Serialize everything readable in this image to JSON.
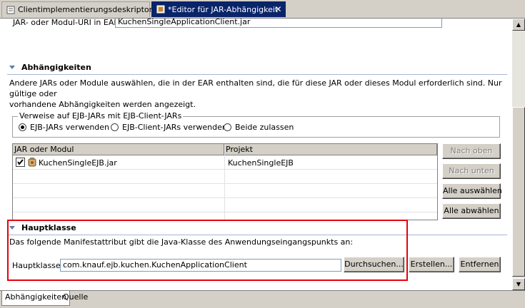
{
  "tabs": [
    {
      "label": "Clientimplementierungsdeskriptor",
      "active": false,
      "icon": "descriptor-icon"
    },
    {
      "label": "*Editor für JAR-Abhängigkeit",
      "active": true,
      "icon": "jar-editor-icon"
    }
  ],
  "ear_uri": {
    "label": "JAR- oder Modul-URI in EAR:",
    "value": "KuchenSingleApplicationClient.jar"
  },
  "dependencies": {
    "title": "Abhängigkeiten",
    "description_line1": "Andere JARs oder Module auswählen, die in der EAR enthalten sind, die für diese JAR oder dieses Modul erforderlich sind.  Nur gültige oder",
    "description_line2": "vorhandene Abhängigkeiten werden angezeigt.",
    "group_label": "Verweise auf EJB-JARs mit EJB-Client-JARs",
    "radios": [
      {
        "label": "EJB-JARs verwenden",
        "selected": true
      },
      {
        "label": "EJB-Client-JARs verwenden",
        "selected": false
      },
      {
        "label": "Beide zulassen",
        "selected": false
      }
    ],
    "table": {
      "headers": [
        "JAR oder Modul",
        "Projekt"
      ],
      "rows": [
        {
          "module": "KuchenSingleEJB.jar",
          "project": "KuchenSingleEJB",
          "checked": true
        }
      ]
    },
    "buttons": {
      "up": "Nach oben",
      "down": "Nach unten",
      "select_all": "Alle auswählen",
      "deselect_all": "Alle abwählen"
    }
  },
  "main_class": {
    "title": "Hauptklasse",
    "description": "Das folgende Manifestattribut gibt die Java-Klasse des Anwendungseingangspunkts an:",
    "label": "Hauptklasse:",
    "value": "com.knauf.ejb.kuchen.KuchenApplicationClient",
    "browse": "Durchsuchen...",
    "create": "Erstellen...",
    "remove": "Entfernen"
  },
  "bottom_tabs": [
    {
      "label": "Abhängigkeiten",
      "selected": true
    },
    {
      "label": "Quelle",
      "selected": false
    }
  ],
  "colors": {
    "highlight": "#e8000c",
    "active_tab": "#0a246a",
    "section_title_line": "#a8b4d0"
  }
}
